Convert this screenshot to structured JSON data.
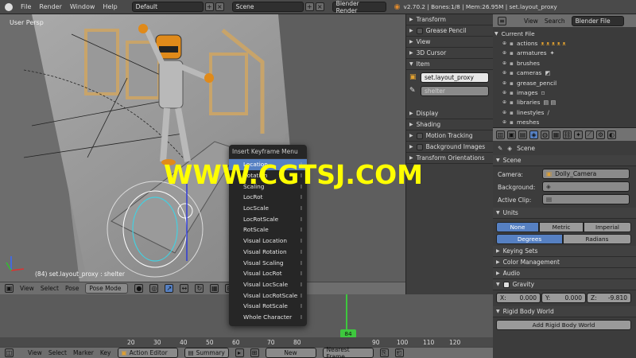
{
  "top_bar": {
    "menus": [
      "File",
      "Render",
      "Window",
      "Help"
    ],
    "layout": "Default",
    "scene": "Scene",
    "engine": "Blender Render",
    "stats": "v2.70.2 | Bones:1/8 | Mem:26.95M | set.layout_proxy"
  },
  "viewport": {
    "view_label": "User Persp",
    "status": "(84) set.layout_proxy : shelter",
    "header": {
      "view": "View",
      "select": "Select",
      "pose": "Pose",
      "mode": "Pose Mode"
    }
  },
  "npanel": {
    "transform": "Transform",
    "grease_pencil": "Grease Pencil",
    "view": "View",
    "cursor": "3D Cursor",
    "item": "Item",
    "item_name": "set.layout_proxy",
    "item_bone": "shelter",
    "display": "Display",
    "shading": "Shading",
    "motion_tracking": "Motion Tracking",
    "background_images": "Background Images",
    "transform_orientations": "Transform Orientations"
  },
  "outliner": {
    "header": {
      "view": "View",
      "search": "Search",
      "display_mode": "Blender File"
    },
    "root": "Current File",
    "items": [
      "actions",
      "armatures",
      "brushes",
      "cameras",
      "grease_pencil",
      "images",
      "libraries",
      "linestyles",
      "meshes"
    ]
  },
  "properties": {
    "scene_label": "Scene",
    "scene_panel": "Scene",
    "camera_label": "Camera:",
    "camera_value": "Dolly_Camera",
    "background_label": "Background:",
    "active_clip_label": "Active Clip:",
    "units": "Units",
    "unit_none": "None",
    "unit_metric": "Metric",
    "unit_imperial": "Imperial",
    "rot_degrees": "Degrees",
    "rot_radians": "Radians",
    "keying_sets": "Keying Sets",
    "color_management": "Color Management",
    "audio": "Audio",
    "gravity": "Gravity",
    "grav_x": "X:",
    "grav_x_val": "0.000",
    "grav_y": "Y:",
    "grav_y_val": "0.000",
    "grav_z": "Z:",
    "grav_z_val": "-9.810",
    "rigid_body_world": "Rigid Body World",
    "add_rigid_body_world": "Add Rigid Body World"
  },
  "key_menu": {
    "title": "Insert Keyframe Menu",
    "items": [
      "Location",
      "Rotation",
      "Scaling",
      "LocRot",
      "LocScale",
      "LocRotScale",
      "RotScale",
      "Visual Location",
      "Visual Rotation",
      "Visual Scaling",
      "Visual LocRot",
      "Visual LocScale",
      "Visual LocRotScale",
      "Visual RotScale",
      "Whole Character"
    ]
  },
  "timeline": {
    "ticks": [
      "20",
      "30",
      "40",
      "50",
      "60",
      "70",
      "80",
      "90",
      "100",
      "110",
      "120"
    ],
    "current_frame": "84"
  },
  "timeline_header": {
    "view": "View",
    "select": "Select",
    "marker": "Marker",
    "key": "Key",
    "editor": "Action Editor",
    "summary": "Summary",
    "new": "New",
    "nearest": "Nearest Frame"
  },
  "watermark": "WWW.CGTSJ.COM"
}
